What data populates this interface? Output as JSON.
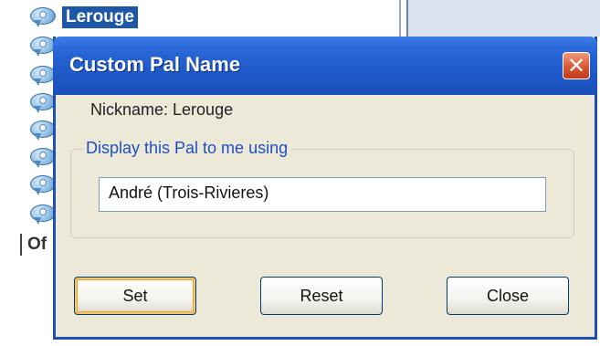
{
  "background": {
    "selected_contact": "Lerouge",
    "section_label_partial": "Of"
  },
  "dialog": {
    "title": "Custom Pal Name",
    "close_symbol": "✕",
    "nickname_label": "Nickname: Lerouge",
    "group_label": "Display this Pal to me using",
    "display_name_value": "André (Trois-Rivieres)",
    "buttons": {
      "set": "Set",
      "reset": "Reset",
      "close": "Close"
    }
  },
  "colors": {
    "titlebar": "#2a68d8",
    "selection": "#1c57a8",
    "group_label": "#1d4fc4",
    "dialog_bg": "#ece9d8"
  },
  "icons": {
    "contact": "buddy-bubble-icon",
    "close": "close-icon"
  }
}
